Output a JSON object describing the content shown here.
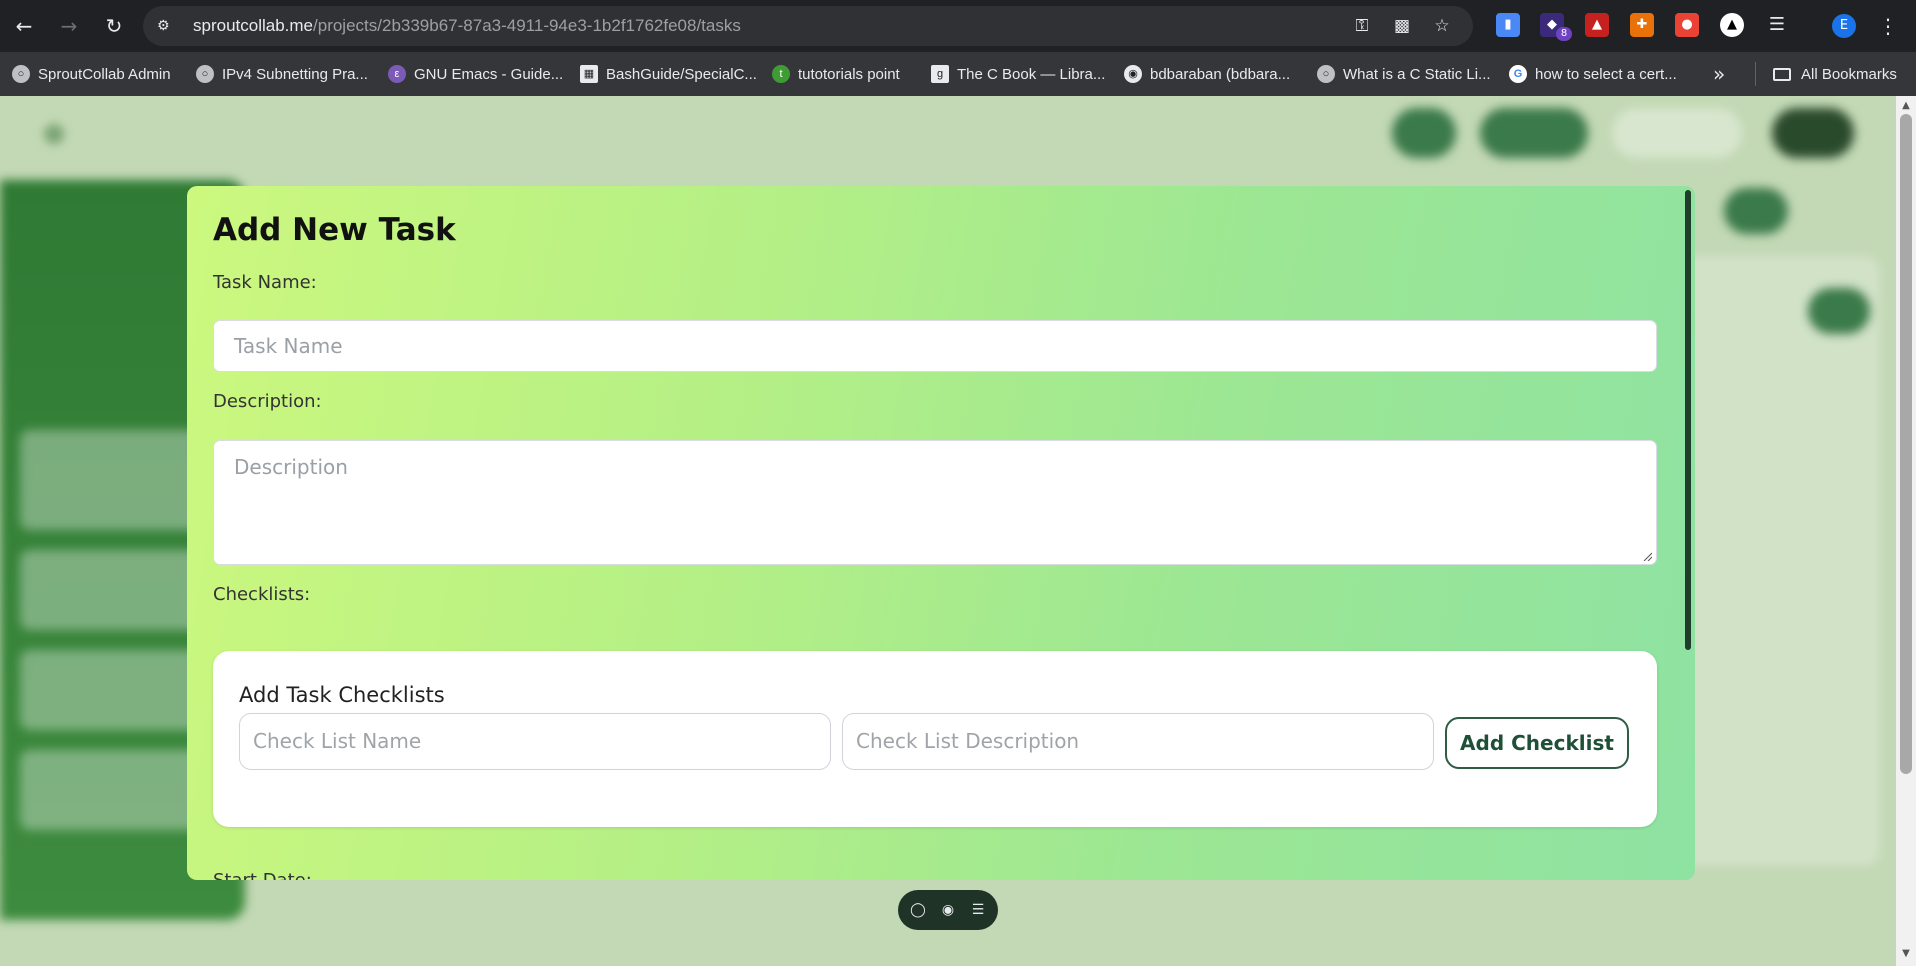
{
  "browser": {
    "url_host": "sproutcollab.me",
    "url_path": "/projects/2b339b67-87a3-4911-94e3-1b2f1762fe08/tasks",
    "extension_badge": "8",
    "profile_initial": "E",
    "bookmarks": [
      {
        "label": "SproutCollab Admin",
        "icon": "globe-icon"
      },
      {
        "label": "IPv4 Subnetting Pra...",
        "icon": "globe-icon"
      },
      {
        "label": "GNU Emacs - Guide...",
        "icon": "emacs-icon"
      },
      {
        "label": "BashGuide/SpecialC...",
        "icon": "page-icon"
      },
      {
        "label": "tutotorials point",
        "icon": "tutorialspoint-icon"
      },
      {
        "label": "The C Book — Libra...",
        "icon": "gnu-icon"
      },
      {
        "label": "bdbaraban (bdbara...",
        "icon": "github-icon"
      },
      {
        "label": "What is a C Static Li...",
        "icon": "globe-icon"
      },
      {
        "label": "how to select a cert...",
        "icon": "google-icon"
      }
    ],
    "all_bookmarks_label": "All Bookmarks"
  },
  "modal": {
    "title": "Add New Task",
    "task_name_label": "Task Name:",
    "task_name_placeholder": "Task Name",
    "description_label": "Description:",
    "description_placeholder": "Description",
    "checklists_label": "Checklists:",
    "checklist_card": {
      "title": "Add Task Checklists",
      "name_placeholder": "Check List Name",
      "description_placeholder": "Check List Description",
      "add_button": "Add Checklist"
    },
    "start_date_label": "Start Date:"
  },
  "colors": {
    "modal_gradient_start": "#ccf87e",
    "modal_gradient_end": "#8ee2a2",
    "accent_dark_green": "#1f4f36",
    "browser_chrome": "#202124"
  }
}
